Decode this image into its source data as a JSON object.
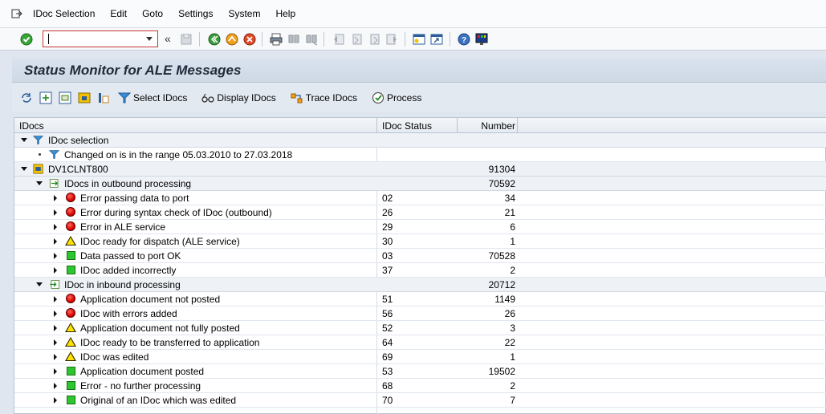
{
  "menu": {
    "items": [
      "IDoc Selection",
      "Edit",
      "Goto",
      "Settings",
      "System",
      "Help"
    ]
  },
  "toolbar": {
    "command_value": "",
    "icons": [
      "enter-check-icon",
      "back-icon",
      "exit-icon",
      "cancel-icon",
      "print-icon",
      "find-icon",
      "find-next-icon",
      "first-page-icon",
      "prev-page-icon",
      "next-page-icon",
      "last-page-icon",
      "new-session-icon",
      "shortcut-icon",
      "help-icon",
      "customize-layout-icon"
    ]
  },
  "title": "Status Monitor for ALE Messages",
  "app_toolbar": {
    "select_idocs": "Select IDocs",
    "display_idocs": "Display IDocs",
    "trace_idocs": "Trace IDocs",
    "process": "Process"
  },
  "table": {
    "headers": {
      "idocs": "IDocs",
      "status": "IDoc Status",
      "number": "Number"
    },
    "selection": {
      "label": "IDoc selection",
      "criteria": "Changed on is in the range 05.03.2010 to 27.03.2018"
    },
    "system": {
      "label": "DV1CLNT800",
      "number": "91304"
    },
    "outbound": {
      "label": "IDocs in outbound processing",
      "number": "70592",
      "rows": [
        {
          "icon": "red",
          "label": "Error passing data to port",
          "status": "02",
          "number": "34"
        },
        {
          "icon": "red",
          "label": "Error during syntax check of IDoc (outbound)",
          "status": "26",
          "number": "21"
        },
        {
          "icon": "red",
          "label": "Error in ALE service",
          "status": "29",
          "number": "6"
        },
        {
          "icon": "yellow",
          "label": "IDoc ready for dispatch (ALE service)",
          "status": "30",
          "number": "1"
        },
        {
          "icon": "green",
          "label": "Data passed to port OK",
          "status": "03",
          "number": "70528"
        },
        {
          "icon": "green",
          "label": "IDoc added incorrectly",
          "status": "37",
          "number": "2"
        }
      ]
    },
    "inbound": {
      "label": "IDoc in inbound processing",
      "number": "20712",
      "rows": [
        {
          "icon": "red",
          "label": "Application document not posted",
          "status": "51",
          "number": "1149"
        },
        {
          "icon": "red",
          "label": "IDoc with errors added",
          "status": "56",
          "number": "26"
        },
        {
          "icon": "yellow",
          "label": "Application document not fully posted",
          "status": "52",
          "number": "3"
        },
        {
          "icon": "yellow",
          "label": "IDoc ready to be transferred to application",
          "status": "64",
          "number": "22"
        },
        {
          "icon": "yellow",
          "label": "IDoc was edited",
          "status": "69",
          "number": "1"
        },
        {
          "icon": "green",
          "label": "Application document posted",
          "status": "53",
          "number": "19502"
        },
        {
          "icon": "green",
          "label": "Error - no further processing",
          "status": "68",
          "number": "2"
        },
        {
          "icon": "green",
          "label": "Original of an IDoc which was edited",
          "status": "70",
          "number": "7"
        }
      ]
    }
  }
}
